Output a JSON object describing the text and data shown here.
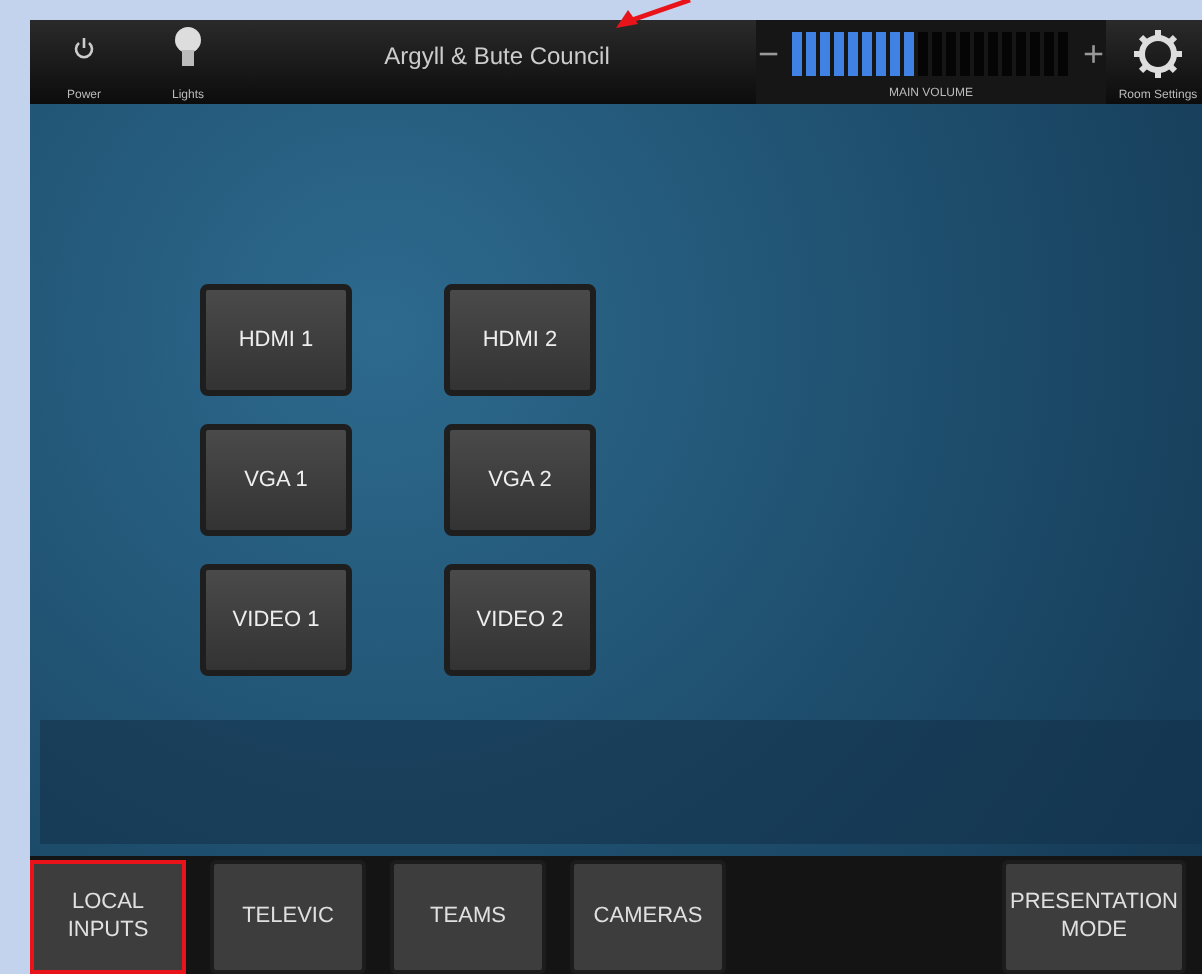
{
  "header": {
    "title": "Argyll & Bute Council",
    "power_label": "Power",
    "lights_label": "Lights",
    "volume": {
      "minus": "−",
      "plus": "+",
      "label": "MAIN VOLUME",
      "level": 0.45
    },
    "settings_label": "Room Settings"
  },
  "sources": [
    {
      "label": "HDMI 1"
    },
    {
      "label": "HDMI 2"
    },
    {
      "label": "VGA 1"
    },
    {
      "label": "VGA 2"
    },
    {
      "label": "VIDEO 1"
    },
    {
      "label": "VIDEO 2"
    }
  ],
  "tabs": [
    {
      "label": "LOCAL\nINPUTS",
      "highlighted": true
    },
    {
      "label": "TELEVIC",
      "highlighted": false
    },
    {
      "label": "TEAMS",
      "highlighted": false
    },
    {
      "label": "CAMERAS",
      "highlighted": false
    },
    {
      "label": "PRESENTATION\nMODE",
      "highlighted": false
    }
  ]
}
